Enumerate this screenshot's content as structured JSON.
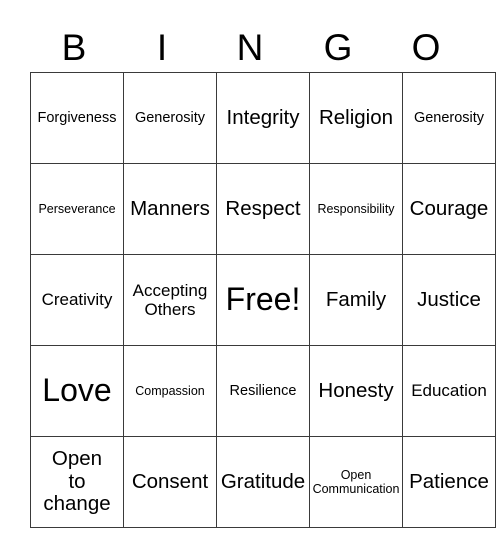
{
  "card": {
    "title": "BINGO",
    "header_letters": [
      "B",
      "I",
      "N",
      "G",
      "O"
    ],
    "columns": 5,
    "rows": 5,
    "border_color": "#3a3a3a",
    "background_color": "#ffffff",
    "text_color": "#000000",
    "free_space": "Free!",
    "cells": [
      [
        {
          "text": "Forgiveness",
          "size": "sz-s",
          "lines": [
            "Forgiveness"
          ]
        },
        {
          "text": "Generosity",
          "size": "sz-s",
          "lines": [
            "Generosity"
          ]
        },
        {
          "text": "Integrity",
          "size": "sz-l",
          "lines": [
            "Integrity"
          ]
        },
        {
          "text": "Religion",
          "size": "sz-l",
          "lines": [
            "Religion"
          ]
        },
        {
          "text": "Generosity",
          "size": "sz-s",
          "lines": [
            "Generosity"
          ]
        }
      ],
      [
        {
          "text": "Perseverance",
          "size": "sz-xs",
          "lines": [
            "Perseverance"
          ]
        },
        {
          "text": "Manners",
          "size": "sz-l",
          "lines": [
            "Manners"
          ]
        },
        {
          "text": "Respect",
          "size": "sz-l",
          "lines": [
            "Respect"
          ]
        },
        {
          "text": "Responsibility",
          "size": "sz-xs",
          "lines": [
            "Responsibility"
          ]
        },
        {
          "text": "Courage",
          "size": "sz-l",
          "lines": [
            "Courage"
          ]
        }
      ],
      [
        {
          "text": "Creativity",
          "size": "sz-m",
          "lines": [
            "Creativity"
          ]
        },
        {
          "text": "Accepting Others",
          "size": "sz-m",
          "lines": [
            "Accepting",
            "Others"
          ]
        },
        {
          "text": "Free!",
          "size": "sz-xl",
          "lines": [
            "Free!"
          ]
        },
        {
          "text": "Family",
          "size": "sz-l",
          "lines": [
            "Family"
          ]
        },
        {
          "text": "Justice",
          "size": "sz-l",
          "lines": [
            "Justice"
          ]
        }
      ],
      [
        {
          "text": "Love",
          "size": "sz-xl",
          "lines": [
            "Love"
          ]
        },
        {
          "text": "Compassion",
          "size": "sz-xs",
          "lines": [
            "Compassion"
          ]
        },
        {
          "text": "Resilience",
          "size": "sz-s",
          "lines": [
            "Resilience"
          ]
        },
        {
          "text": "Honesty",
          "size": "sz-l",
          "lines": [
            "Honesty"
          ]
        },
        {
          "text": "Education",
          "size": "sz-m",
          "lines": [
            "Education"
          ]
        }
      ],
      [
        {
          "text": "Open to change",
          "size": "sz-l",
          "lines": [
            "Open",
            "to",
            "change"
          ]
        },
        {
          "text": "Consent",
          "size": "sz-l",
          "lines": [
            "Consent"
          ]
        },
        {
          "text": "Gratitude",
          "size": "sz-l",
          "lines": [
            "Gratitude"
          ]
        },
        {
          "text": "Open Communication",
          "size": "sz-xs",
          "lines": [
            "Open",
            "Communication"
          ]
        },
        {
          "text": "Patience",
          "size": "sz-l",
          "lines": [
            "Patience"
          ]
        }
      ]
    ]
  }
}
